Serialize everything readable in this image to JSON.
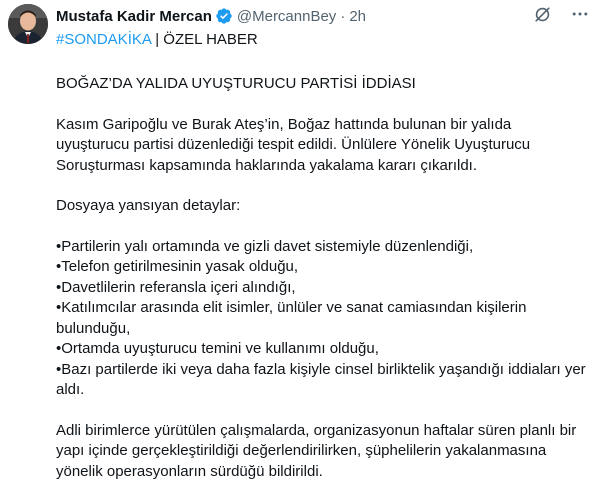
{
  "author": {
    "name": "Mustafa Kadir Mercan",
    "handle": "@MercannBey",
    "separator": "·",
    "time": "2h"
  },
  "tagline": {
    "hashtag": "#SONDAKİKA",
    "rest": " | ÖZEL HABER"
  },
  "post": {
    "headline": "BOĞAZ’DA YALIDA UYUŞTURUCU PARTİSİ İDDİASI",
    "paragraph1": "Kasım Garipoğlu ve Burak Ateş’in, Boğaz hattında bulunan bir yalıda uyuşturucu partisi düzenlediği tespit edildi. Ünlülere Yönelik Uyuşturucu Soruşturması kapsamında haklarında yakalama kararı çıkarıldı.",
    "details_intro": "Dosyaya yansıyan detaylar:",
    "bullets": [
      "•Partilerin yalı ortamında ve gizli davet sistemiyle düzenlendiği,",
      "•Telefon getirilmesinin yasak olduğu,",
      "•Davetlilerin referansla içeri alındığı,",
      "•Katılımcılar arasında elit isimler, ünlüler ve sanat camiasından kişilerin bulunduğu,",
      "•Ortamda uyuşturucu temini ve kullanımı olduğu,",
      "•Bazı partilerde iki veya daha fazla kişiyle cinsel birliktelik yaşandığı iddiaları yer aldı."
    ],
    "closing": "Adli birimlerce yürütülen çalışmalarda, organizasyonun haftalar süren planlı bir yapı içinde gerçekleştirildiği değerlendirilirken, şüphelilerin yakalanmasına yönelik operasyonların sürdüğü bildirildi."
  },
  "icons": {
    "verified": "verified-badge-icon",
    "grok": "grok-icon",
    "more": "more-icon"
  },
  "colors": {
    "hashtag": "#1d9bf0",
    "verified": "#1d9bf0",
    "secondary_text": "#536471"
  }
}
